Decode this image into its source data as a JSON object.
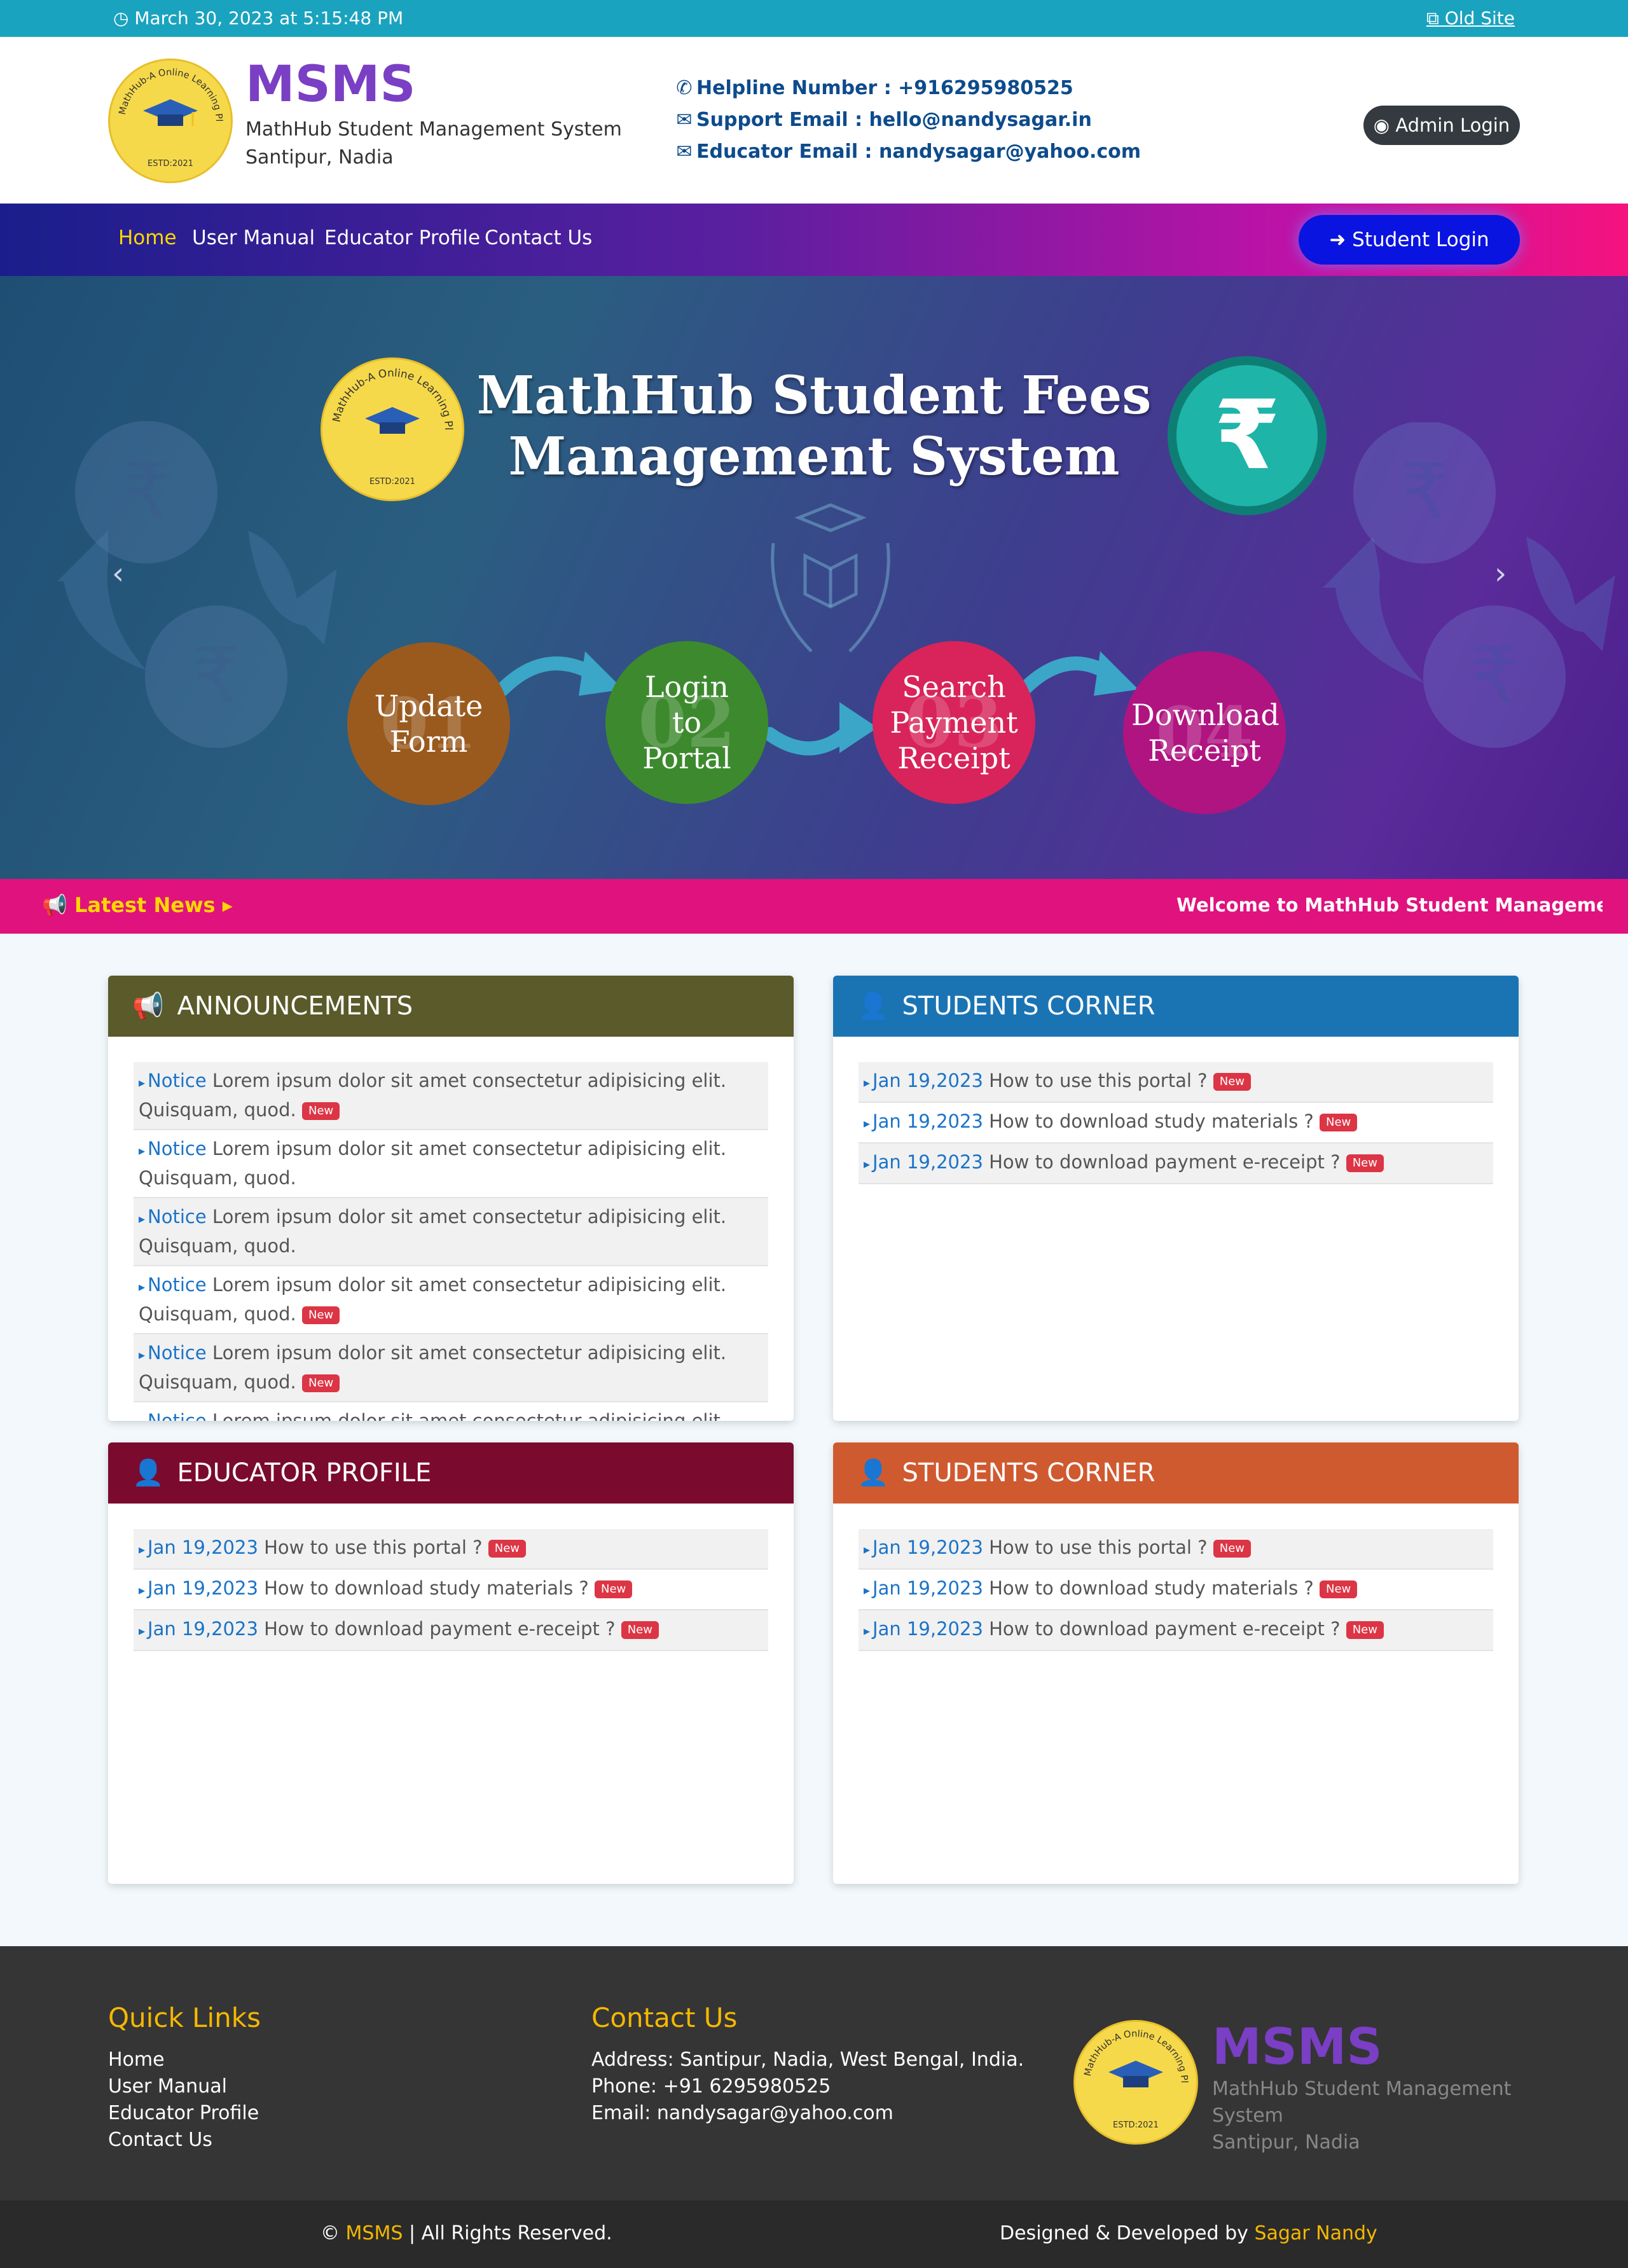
{
  "topbar": {
    "datetime": "March 30, 2023 at 5:15:48 PM",
    "old_site": "Old Site"
  },
  "header": {
    "logo_ring_text": "MathHub-A Online Learning Platform",
    "logo_estd": "ESTD:2021",
    "brand": "MSMS",
    "subtitle": "MathHub Student Management System",
    "location": "Santipur, Nadia",
    "helpline": "Helpline Number : +916295980525",
    "support_email": "Support Email : hello@nandysagar.in",
    "educator_email": "Educator Email : nandysagar@yahoo.com",
    "admin_login": "Admin Login"
  },
  "nav": {
    "items": [
      "Home",
      "User Manual",
      "Educator Profile",
      "Contact Us"
    ],
    "student_login": "Student Login"
  },
  "banner": {
    "title": "MathHub Student Fees Management System",
    "steps": [
      {
        "num": "01",
        "label": "Update Form"
      },
      {
        "num": "02",
        "label": "Login to Portal"
      },
      {
        "num": "03",
        "label": "Search Payment Receipt"
      },
      {
        "num": "04",
        "label": "Download Receipt"
      }
    ]
  },
  "news": {
    "label": "Latest News",
    "ticker": "Welcome to MathHub Student Management Sy"
  },
  "announcements": {
    "title": "ANNOUNCEMENTS",
    "items": [
      {
        "tag": "Notice",
        "text": "Lorem ipsum dolor sit amet consectetur adipisicing elit. Quisquam, quod.",
        "new": true
      },
      {
        "tag": "Notice",
        "text": "Lorem ipsum dolor sit amet consectetur adipisicing elit. Quisquam, quod.",
        "new": false
      },
      {
        "tag": "Notice",
        "text": "Lorem ipsum dolor sit amet consectetur adipisicing elit. Quisquam, quod.",
        "new": false
      },
      {
        "tag": "Notice",
        "text": "Lorem ipsum dolor sit amet consectetur adipisicing elit. Quisquam, quod.",
        "new": true
      },
      {
        "tag": "Notice",
        "text": "Lorem ipsum dolor sit amet consectetur adipisicing elit. Quisquam, quod.",
        "new": true
      },
      {
        "tag": "Notice",
        "text": "Lorem ipsum dolor sit amet consectetur adipisicing elit. Quisquam, quod.",
        "new": false
      }
    ]
  },
  "students_corner_1": {
    "title": "STUDENTS CORNER",
    "items": [
      {
        "tag": "Jan 19,2023",
        "text": "How to use this portal ?",
        "new": true
      },
      {
        "tag": "Jan 19,2023",
        "text": "How to download study materials ?",
        "new": true
      },
      {
        "tag": "Jan 19,2023",
        "text": "How to download payment e-receipt ?",
        "new": true
      }
    ]
  },
  "educator_profile": {
    "title": "EDUCATOR PROFILE",
    "items": [
      {
        "tag": "Jan 19,2023",
        "text": "How to use this portal ?",
        "new": true
      },
      {
        "tag": "Jan 19,2023",
        "text": "How to download study materials ?",
        "new": true
      },
      {
        "tag": "Jan 19,2023",
        "text": "How to download payment e-receipt ?",
        "new": true
      }
    ]
  },
  "students_corner_2": {
    "title": "STUDENTS CORNER",
    "items": [
      {
        "tag": "Jan 19,2023",
        "text": "How to use this portal ?",
        "new": true
      },
      {
        "tag": "Jan 19,2023",
        "text": "How to download study materials ?",
        "new": true
      },
      {
        "tag": "Jan 19,2023",
        "text": "How to download payment e-receipt ?",
        "new": true
      }
    ]
  },
  "new_badge": "New",
  "footer": {
    "quick_links_title": "Quick Links",
    "quick_links": [
      "Home",
      "User Manual",
      "Educator Profile",
      "Contact Us"
    ],
    "contact_title": "Contact Us",
    "address": "Address: Santipur, Nadia, West Bengal, India.",
    "phone": "Phone: +91 6295980525",
    "email": "Email: nandysagar@yahoo.com",
    "brand": "MSMS",
    "subtitle_line1": "MathHub Student Management",
    "subtitle_line2": "System",
    "location": "Santipur, Nadia"
  },
  "copyright": {
    "prefix": "©",
    "brand": "MSMS",
    "suffix": "| All Rights Reserved.",
    "designed_by": "Designed & Developed by",
    "author": "Sagar Nandy"
  },
  "colors": {
    "announcements": "#5a5a2a",
    "students_corner_1": "#1a74b4",
    "educator_profile": "#7a0a2e",
    "students_corner_2": "#cf5a30"
  }
}
